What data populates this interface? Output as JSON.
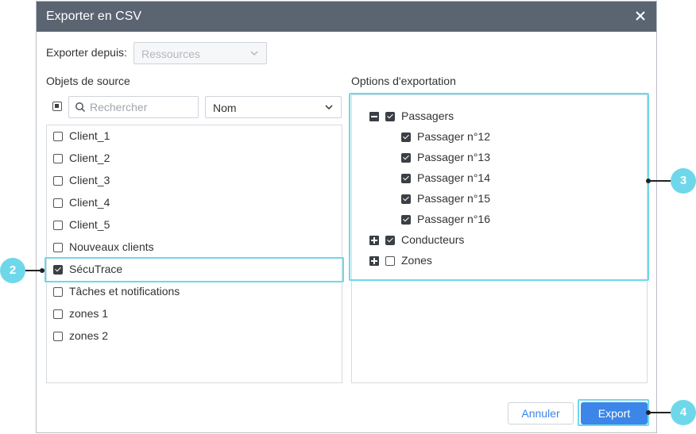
{
  "dialog": {
    "title": "Exporter en CSV",
    "close_icon": "close-icon"
  },
  "export_from": {
    "label": "Exporter depuis:",
    "value": "Ressources",
    "disabled": true
  },
  "source_objects": {
    "heading": "Objets de source",
    "search_placeholder": "Rechercher",
    "sort_value": "Nom",
    "items": [
      {
        "label": "Client_1",
        "checked": false
      },
      {
        "label": "Client_2",
        "checked": false
      },
      {
        "label": "Client_3",
        "checked": false
      },
      {
        "label": "Client_4",
        "checked": false
      },
      {
        "label": "Client_5",
        "checked": false
      },
      {
        "label": "Nouveaux clients",
        "checked": false
      },
      {
        "label": "SécuTrace",
        "checked": true
      },
      {
        "label": "Tâches et notifications",
        "checked": false
      },
      {
        "label": "zones 1",
        "checked": false
      },
      {
        "label": "zones 2",
        "checked": false
      }
    ]
  },
  "export_options": {
    "heading": "Options d'exportation",
    "tree": [
      {
        "label": "Passagers",
        "checked": true,
        "expanded": true,
        "children": [
          {
            "label": "Passager n°12",
            "checked": true
          },
          {
            "label": "Passager n°13",
            "checked": true
          },
          {
            "label": "Passager n°14",
            "checked": true
          },
          {
            "label": "Passager n°15",
            "checked": true
          },
          {
            "label": "Passager n°16",
            "checked": true
          }
        ]
      },
      {
        "label": "Conducteurs",
        "checked": true,
        "expanded": false
      },
      {
        "label": "Zones",
        "checked": false,
        "expanded": false
      }
    ]
  },
  "footer": {
    "cancel_label": "Annuler",
    "export_label": "Export"
  },
  "callouts": [
    "2",
    "3",
    "4"
  ],
  "colors": {
    "titlebar": "#5b6471",
    "accent": "#3b86e8",
    "highlight": "#6ed8ea"
  }
}
